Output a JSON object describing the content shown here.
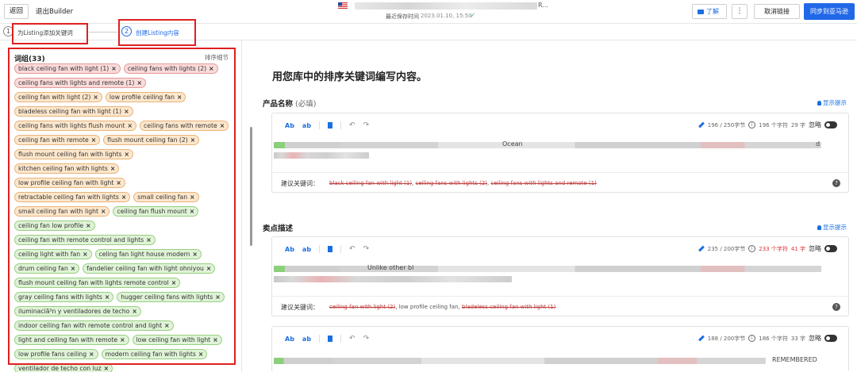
{
  "header": {
    "back_label": "返回",
    "exit_label": "退出Builder",
    "title_suffix": "R...",
    "save_label": "最近保存时间",
    "save_time": "2023.01.10, 15:50",
    "learn_label": "了解",
    "more_label": "⋮",
    "unlink_label": "取消链接",
    "sync_label": "同步到亚马逊"
  },
  "steps": [
    {
      "num": "1",
      "label": "为Listing添加关键词"
    },
    {
      "num": "2",
      "label": "创建Listing内容"
    }
  ],
  "keywords": {
    "title": "词组(33)",
    "sort_label": "排序细节",
    "tags": [
      {
        "text": "black ceiling fan with light (1)",
        "status": "red"
      },
      {
        "text": "ceiling fans with lights (2)",
        "status": "red"
      },
      {
        "text": "ceiling fans with lights and remote (1)",
        "status": "red"
      },
      {
        "text": "ceiling fan with light (2)",
        "status": "orange"
      },
      {
        "text": "low profile ceiling fan",
        "status": "orange"
      },
      {
        "text": "bladeless ceiling fan with light (1)",
        "status": "orange"
      },
      {
        "text": "ceiling fans with lights flush mount",
        "status": "orange"
      },
      {
        "text": "ceiling fans with remote",
        "status": "orange"
      },
      {
        "text": "ceiling fan with remote",
        "status": "orange"
      },
      {
        "text": "flush mount ceiling fan (2)",
        "status": "orange"
      },
      {
        "text": "flush mount ceiling fan with lights",
        "status": "orange"
      },
      {
        "text": "kitchen ceiling fan with lights",
        "status": "orange"
      },
      {
        "text": "low profile ceiling fan with light",
        "status": "orange"
      },
      {
        "text": "retractable ceiling fan with lights",
        "status": "orange"
      },
      {
        "text": "small ceiling fan",
        "status": "orange"
      },
      {
        "text": "small ceiling fan with light",
        "status": "orange"
      },
      {
        "text": "ceiling fan flush mount",
        "status": "green"
      },
      {
        "text": "ceiling fan low profile",
        "status": "green"
      },
      {
        "text": "ceiling fan with remote control and lights",
        "status": "green"
      },
      {
        "text": "ceiling light with fan",
        "status": "green"
      },
      {
        "text": "celing fan light house modern",
        "status": "green"
      },
      {
        "text": "drum ceiling fan",
        "status": "green"
      },
      {
        "text": "fandelier ceiling fan with light ohniyou",
        "status": "green"
      },
      {
        "text": "flush mount ceiling fan with lights remote control",
        "status": "green"
      },
      {
        "text": "gray ceiling fans with lights",
        "status": "green"
      },
      {
        "text": "hugger ceiling fans with lights",
        "status": "green"
      },
      {
        "text": "iluminaciã³n y ventiladores de techo",
        "status": "green"
      },
      {
        "text": "indoor ceiling fan with remote control and light",
        "status": "green"
      },
      {
        "text": "light and ceiling fan with remote",
        "status": "green"
      },
      {
        "text": "low ceiling fan with light",
        "status": "green"
      },
      {
        "text": "low profile fans ceiling",
        "status": "green"
      },
      {
        "text": "modern ceiling fan with lights",
        "status": "green"
      },
      {
        "text": "ventilador de techo con luz",
        "status": "green"
      }
    ]
  },
  "main": {
    "heading": "用您库中的排序关键词编写内容。",
    "show_hint": "显示提示",
    "ignore_label": "忽略",
    "suggest_label": "建议关键词：",
    "toolbar": {
      "ab_upper": "Ab",
      "ab_lower": "ab",
      "undo": "↶",
      "redo": "↷"
    },
    "product_name": {
      "title": "产品名称",
      "required": "(必填)",
      "bytes": "196 / 250字节",
      "chars": "196 个字符",
      "words": "29 字",
      "frag_a": "Ocean",
      "frag_b": "d",
      "suggest": [
        {
          "text": "black ceiling fan with light (1)",
          "used": true
        },
        {
          "text": "ceiling fans with lights (2)",
          "used": true
        },
        {
          "text": "ceiling fans with lights and remote (1)",
          "used": true
        }
      ]
    },
    "bullets": {
      "title": "卖点描述",
      "bytes": "235 / 200字节",
      "chars": "233 个字符",
      "words": "41 字",
      "frag_a": "Unlike other bl",
      "suggest": [
        {
          "text": "ceiling fan with light (2)",
          "used": true
        },
        {
          "text": "low profile ceiling fan",
          "used": false
        },
        {
          "text": "bladeless ceiling fan with light (1)",
          "used": true
        }
      ]
    },
    "bullet2": {
      "bytes": "188 / 200字节",
      "chars": "186 个字符",
      "words": "33 字",
      "frag_a": "REMEMBERED"
    }
  },
  "colors": {
    "accent": "#2168e8",
    "tag_red": "#fbdada",
    "tag_orange": "#fde7cc",
    "tag_green": "#dff3d6",
    "highlight_red": "#e02020"
  }
}
